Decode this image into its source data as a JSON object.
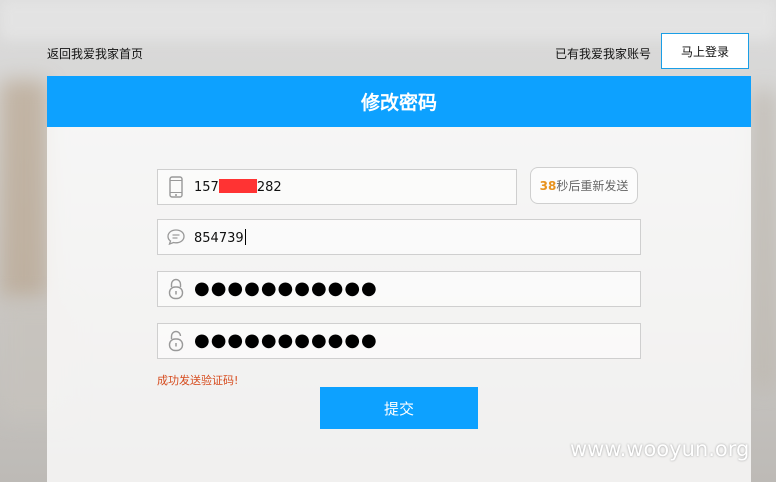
{
  "header": {
    "home_link": "返回我爱我家首页",
    "have_account": "已有我爱我家账号",
    "login_button": "马上登录"
  },
  "panel": {
    "title": "修改密码"
  },
  "form": {
    "phone_prefix": "157",
    "phone_suffix": "282",
    "verification_code": "854739",
    "password_mask": "●●●●●●●●●●●",
    "confirm_password_mask": "●●●●●●●●●●●",
    "resend_countdown": "38",
    "resend_text": "秒后重新发送",
    "success_message": "成功发送验证码!",
    "submit_label": "提交"
  },
  "watermark": "www.wooyun.org",
  "icons": {
    "phone": "phone-icon",
    "message": "message-icon",
    "lock": "lock-icon",
    "unlock": "unlock-icon"
  },
  "colors": {
    "accent": "#0da1ff",
    "countdown": "#e8931f",
    "success": "#d64b1d"
  }
}
